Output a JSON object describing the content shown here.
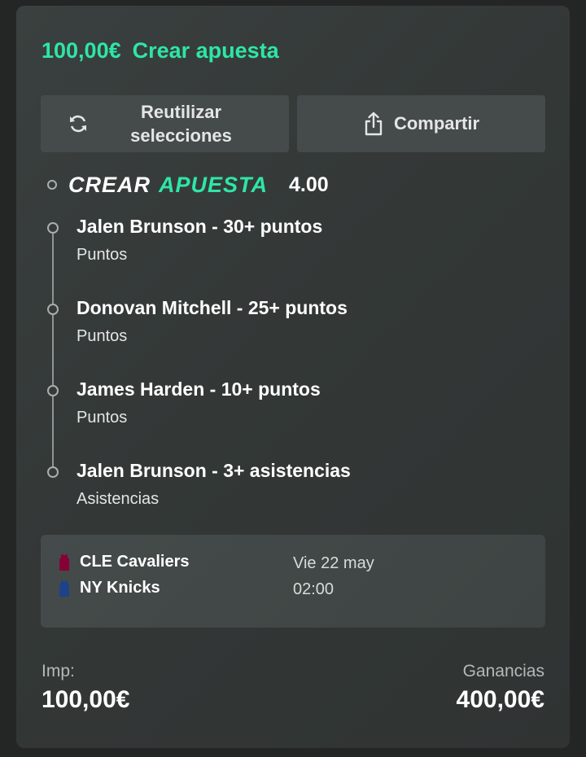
{
  "header": {
    "amount": "100,00€",
    "title": "Crear apuesta"
  },
  "buttons": {
    "reuse_label_line1": "Reutilizar",
    "reuse_label_line2": "selecciones",
    "share_label": "Compartir"
  },
  "bet_builder": {
    "word1": "CREAR",
    "word2": "APUESTA",
    "odds": "4.00"
  },
  "selections": [
    {
      "name": "Jalen Brunson - 30+ puntos",
      "market": "Puntos"
    },
    {
      "name": "Donovan Mitchell - 25+ puntos",
      "market": "Puntos"
    },
    {
      "name": "James Harden - 10+ puntos",
      "market": "Puntos"
    },
    {
      "name": "Jalen Brunson - 3+ asistencias",
      "market": "Asistencias"
    }
  ],
  "event": {
    "team1": "CLE Cavaliers",
    "team2": "NY Knicks",
    "date": "Vie 22 may",
    "time": "02:00",
    "team1_color": "#860038",
    "team2_color": "#1d428a"
  },
  "footer": {
    "stake_label": "Imp:",
    "stake_value": "100,00€",
    "winnings_label": "Ganancias",
    "winnings_value": "400,00€"
  },
  "colors": {
    "accent": "#2ee6a6",
    "card_bg": "#363b3a",
    "button_bg": "#454b4a"
  }
}
